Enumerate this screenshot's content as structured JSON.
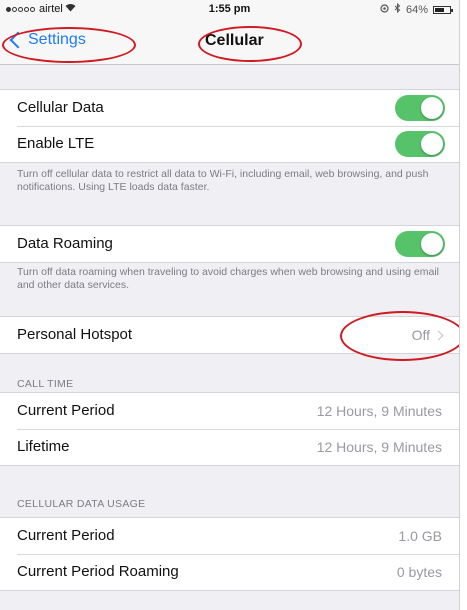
{
  "status_bar": {
    "carrier": "airtel",
    "time": "1:55 pm",
    "battery": "64%",
    "battery_level": 0.64,
    "icons": [
      "signal-dots-icon",
      "wifi-icon",
      "location-icon",
      "bluetooth-icon",
      "battery-icon"
    ]
  },
  "nav": {
    "back_label": "Settings",
    "title": "Cellular"
  },
  "cellular_group": {
    "cellular_data": {
      "label": "Cellular Data",
      "on": true
    },
    "enable_lte": {
      "label": "Enable LTE",
      "on": true
    }
  },
  "lte_note": "Turn off cellular data to restrict all data to Wi-Fi, including email, web browsing, and push notifications. Using LTE loads data faster.",
  "roaming": {
    "label": "Data Roaming",
    "on": true
  },
  "roaming_note": "Turn off data roaming when traveling to avoid charges when web browsing and using email and other data services.",
  "hotspot": {
    "label": "Personal Hotspot",
    "value": "Off"
  },
  "call_time": {
    "header": "CALL TIME",
    "rows": [
      {
        "label": "Current Period",
        "value": "12 Hours, 9 Minutes"
      },
      {
        "label": "Lifetime",
        "value": "12 Hours, 9 Minutes"
      }
    ]
  },
  "data_usage": {
    "header": "CELLULAR DATA USAGE",
    "rows": [
      {
        "label": "Current Period",
        "value": "1.0 GB"
      },
      {
        "label": "Current Period Roaming",
        "value": "0 bytes"
      }
    ]
  },
  "colors": {
    "accent_blue": "#1f7cf5",
    "toggle_green": "#56c26a",
    "annotation_red": "#d11a20",
    "background": "#efeff4"
  }
}
